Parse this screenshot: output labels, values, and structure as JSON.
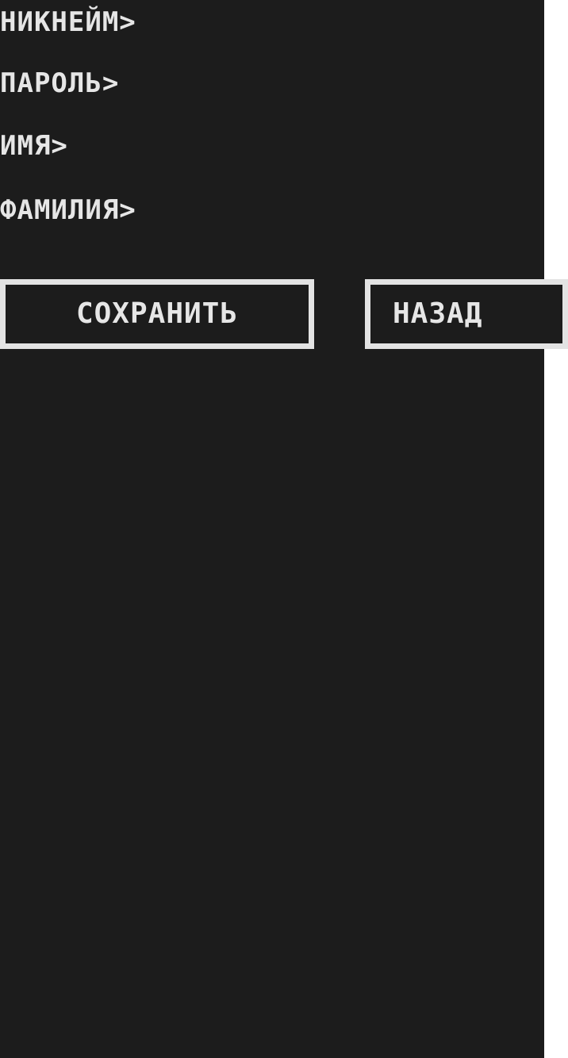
{
  "form": {
    "nickname_label": "НИКНЕЙМ>",
    "password_label": "ПАРОЛЬ>",
    "name_label": "ИМЯ>",
    "surname_label": "ФАМИЛИЯ>"
  },
  "actions": {
    "save_label": "СОХРАНИТЬ",
    "back_label": "НАЗАД"
  },
  "colors": {
    "background": "#1c1c1c",
    "text": "#e6e6e6",
    "button_border": "#e3e3e3"
  }
}
